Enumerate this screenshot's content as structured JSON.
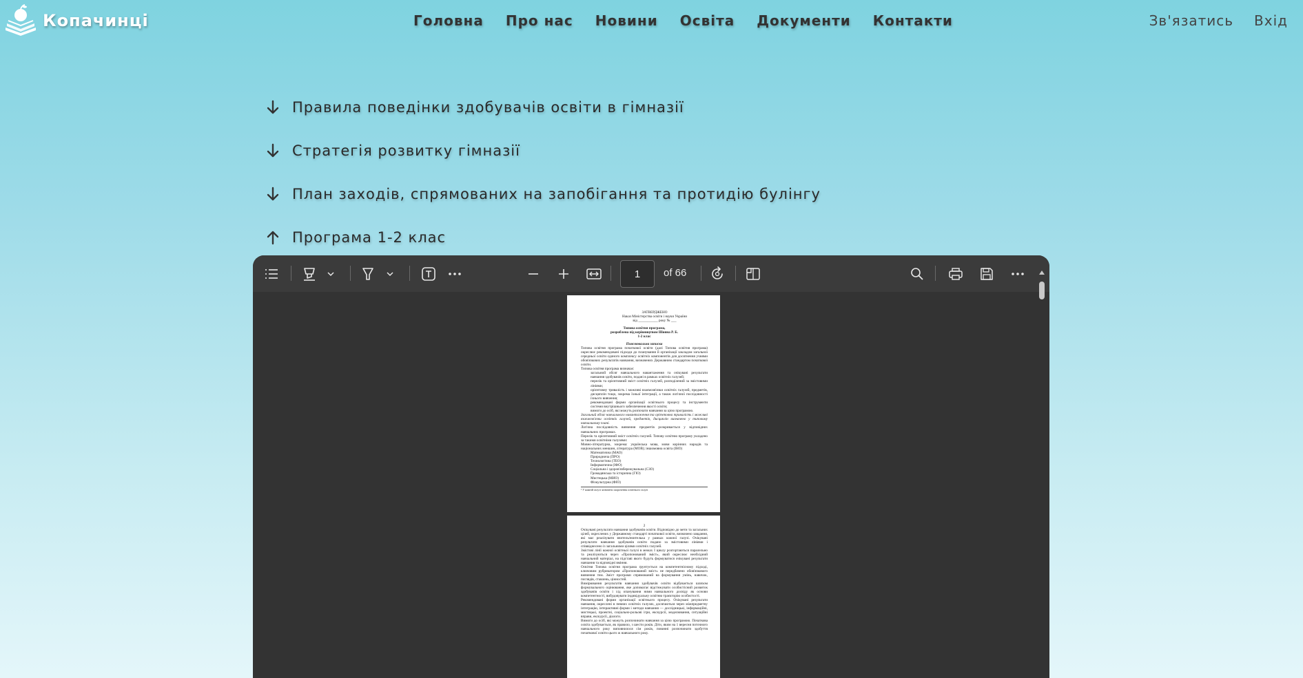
{
  "header": {
    "logo_text": "Копачинці",
    "nav": [
      "Головна",
      "Про нас",
      "Новини",
      "Освіта",
      "Документи",
      "Контакти"
    ],
    "contact": "Зв'язатись",
    "login": "Вхід"
  },
  "documents": [
    {
      "label": "Правила поведінки здобувачів освіти в гімназії",
      "state": "collapsed"
    },
    {
      "label": "Стратегія розвитку гімназії",
      "state": "collapsed"
    },
    {
      "label": "План заходів, спрямованих на запобігання та протидію булінгу",
      "state": "collapsed"
    },
    {
      "label": "Програма 1-2 клас",
      "state": "expanded"
    }
  ],
  "viewer": {
    "page_number": "1",
    "page_count": "of 66",
    "page1": {
      "approved": "ЗАТВЕРДЖЕНО",
      "order_line": "Наказ Міністерства освіти і науки України",
      "date_line": "від ___________ року № ___",
      "title1": "Типова освітня програма,",
      "title2": "розроблена під керівництвом Шияна Р. Б.",
      "title3": "1-2 клас",
      "section": "Пояснювальна записка",
      "para1": "Типова освітня програма початкової освіти (далі Типова освітня програма) окреслює рекомендовані підходи до планування й організації закладом загальної середньої освіти єдиного комплексу освітніх компонентів для досягнення учнями обов'язкових результатів навчання, визначених Державним стандартом початкової освіти.",
      "para2": "Типова освітня програма визначає:",
      "bullet1": "загальний обсяг навчального навантаження та очікувані результати навчання здобувачів освіти, подані в рамках освітніх галузей;",
      "bullet2": "перелік та орієнтовний зміст освітніх галузей, розподілений за змістовими лініями;",
      "bullet3": "орієнтовну тривалість і можливі взаємозв'язки освітніх галузей, предметів, дисциплін тощо, зокрема їхньої інтеграції, а також логічної послідовності їхнього вивчення;",
      "bullet4": "рекомендовані форми організації освітнього процесу та інструменти системи внутрішнього забезпечення якості освіти;",
      "bullet5": "вимоги до осіб, які можуть розпочати навчання за цією програмою.",
      "para3": "Загальний обсяг навчального навантаження та орієнтовна тривалість і можливі взаємозв'язки освітніх галузей, предметів, дисциплін визначено у типовому навчальному плані.",
      "para4": "Логічна послідовність вивчення предметів розкривається у відповідних навчальних програмах.",
      "para5": "Перелік та орієнтовний зміст освітніх галузей. Типову освітню програму укладено за такими освітніми галузями:",
      "para6": "Мовно-літературна, зокрема: українська мова, мови корінних народів та національних меншин, література (МОВ); іншомовна освіта (ІНО)",
      "list": [
        "Математична (МАО)",
        "Природнича (ПРО)",
        "Технологічна (ТЕО)",
        "Інформатична (ІФО)",
        "Соціальна і здоров'язбережувальна (СЗО)",
        "Громадянська та історична (ГІО)",
        "Мистецька (МИО)",
        "Фізкультурна (ФІО)"
      ],
      "footnote": "¹ У кожній галузі зазначено скорочення освітнього галузі"
    },
    "page2": {
      "page_no": "2",
      "para1": "Очікувані результати навчання здобувачів освіти. Відповідно до мети та загальних цілей, окреслених у Державному стандарті початкової освіти, визначено завдання, які має реалізувати вчитель/вчителька у рамках кожної галузі. Очікувані результати навчання здобувачів освіти подано за змістовими лініями і співвіднесено із загальними цілями освітніх галузей.",
      "para2": "Змістові лінії кожної освітньої галузі в межах І циклу розгортаються паралельно та реалізуються через «Пропонований зміст», який окреслює необхідний навчальний матеріал, на підставі якого будуть формуватися очікувані результати навчання та відповідні вміння.",
      "para3": "Освітня Типова освітня програма ґрунтується на компетентнісному підході, ключовим рубрикатором «Пропонований зміст» не передбачено обов'язкового вивчення тем. Зміст програми спрямований на формування умінь, навичок, поглядів, ставлень, цінностей.",
      "para4": "Вимірювання результатів навчання здобувачів освіти відбувається шляхом формувального оцінювання, яке допомагає відстежувати особистісний розвиток здобувачів освіти і хід опанування ними навчального досвіду як основи компетентності, вибудовувати індивідуальну освітню траєкторію особистості.",
      "para5": "Рекомендовані форми організації освітнього процесу. Очікувані результати навчання, окреслені в певних освітніх галузях, досягаються через міжпредметну інтеграцію, інтерактивні форми і методи навчання — дослідницькі, інформаційні, мистецькі, проектні, соціально-рольові ігри, екскурсії, моделювання, ситуаційні вправи, екскурсії, діалоги.",
      "para6": "Вимоги до осіб, які можуть розпочинати навчання за цією програмою. Початкова освіта здобувається, як правило, з шести років. Діти, яким на 1 вересня поточного навчального року виповнилося сім років, повинні розпочинати здобуття початкової освіти цього ж навчального року."
    }
  },
  "colors": {
    "bg_top": "#7fd3e0",
    "bg_bottom": "#e4f6fa",
    "viewer_bg": "#333333",
    "toolbar_bg": "#3b3b3b"
  }
}
